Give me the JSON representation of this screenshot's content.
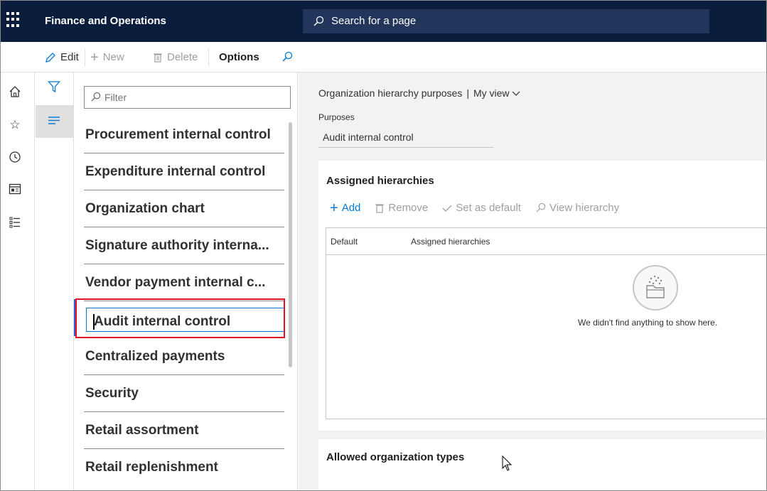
{
  "app": {
    "title": "Finance and Operations"
  },
  "search": {
    "label": "Search for a page"
  },
  "actions": {
    "edit": "Edit",
    "new": "New",
    "delete": "Delete",
    "options": "Options"
  },
  "rail": {
    "icons": [
      "hamburger-icon",
      "home-icon",
      "star-icon",
      "clock-icon",
      "workspace-icon",
      "list-icon"
    ]
  },
  "list": {
    "filter_placeholder": "Filter",
    "items": [
      "Procurement internal control",
      "Expenditure internal control",
      "Organization chart",
      "Signature authority interna...",
      "Vendor payment internal c...",
      "Audit internal control",
      "Centralized payments",
      "Security",
      "Retail assortment",
      "Retail replenishment"
    ],
    "selected_index": 5
  },
  "details": {
    "breadcrumb": "Organization hierarchy purposes",
    "view": "My view",
    "purposes_label": "Purposes",
    "purposes_value": "Audit internal control",
    "assigned": {
      "title": "Assigned hierarchies",
      "toolbar": {
        "add": "Add",
        "remove": "Remove",
        "set_default": "Set as default",
        "view_hierarchy": "View hierarchy"
      },
      "columns": [
        "Default",
        "Assigned hierarchies"
      ],
      "empty_text": "We didn't find anything to show here."
    },
    "allowed": {
      "title": "Allowed organization types"
    }
  },
  "colors": {
    "nav_bg": "#0b1d3c",
    "accent": "#0078d4",
    "highlight": "#e81123"
  }
}
